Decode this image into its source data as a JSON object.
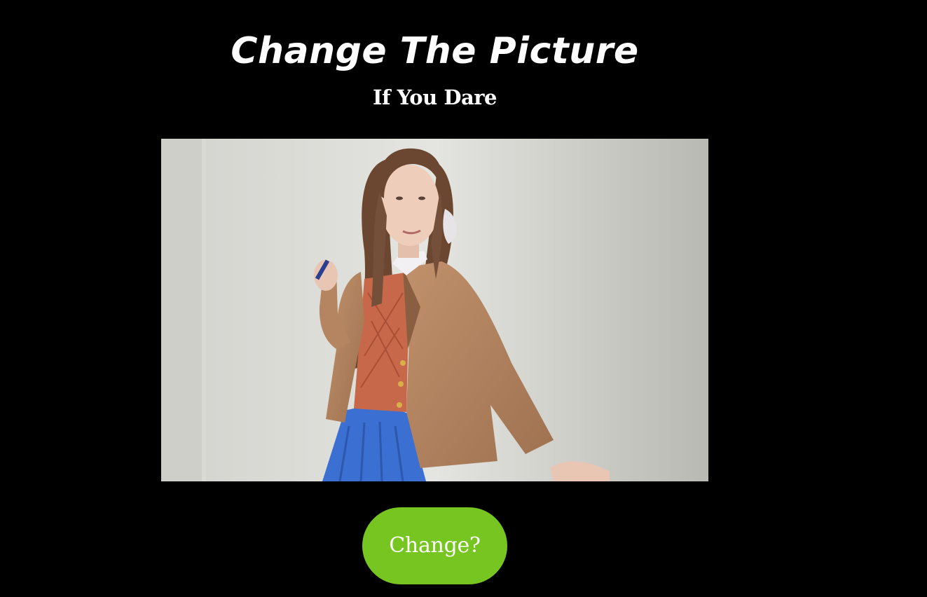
{
  "header": {
    "title": "Change The Picture",
    "subtitle": "If You Dare"
  },
  "picture": {
    "alt": "Portrait photo of a person with long hair in a tan blazer, orange sweater vest and blue pleated skirt against a white wall"
  },
  "button": {
    "label": "Change?"
  },
  "colors": {
    "background": "#000000",
    "text": "#ffffff",
    "button": "#76c520"
  }
}
